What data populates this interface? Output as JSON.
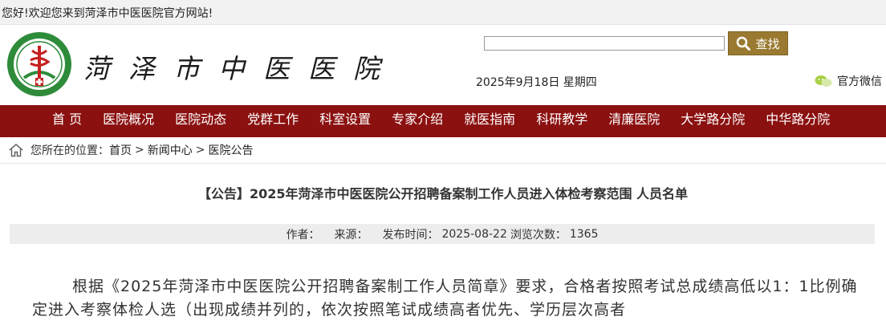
{
  "top_bar": {
    "welcome": "您好!欢迎您来到菏泽市中医医院官方网站!"
  },
  "header": {
    "logo_text": "菏泽市中医医院",
    "search": {
      "placeholder": "",
      "button_label": "查找"
    },
    "date": "2025年9月18日 星期四",
    "wechat_label": "官方微信"
  },
  "nav": {
    "items": [
      "首 页",
      "医院概况",
      "医院动态",
      "党群工作",
      "科室设置",
      "专家介绍",
      "就医指南",
      "科研教学",
      "清廉医院",
      "大学路分院",
      "中华路分院"
    ]
  },
  "breadcrumb": {
    "prefix": "您所在的位置：",
    "items": [
      "首页",
      "新闻中心",
      "医院公告"
    ],
    "separator": ">"
  },
  "article": {
    "title": "【公告】2025年菏泽市中医医院公开招聘备案制工作人员进入体检考察范围 人员名单",
    "meta": {
      "author_label": "作者：",
      "source_label": "来源：",
      "date_label": "发布时间：",
      "date_value": "2025-08-22",
      "views_label": "浏览次数：",
      "views_value": "1365"
    },
    "body": "根据《2025年菏泽市中医医院公开招聘备案制工作人员简章》要求，合格者按照考试总成绩高低以1：1比例确定进入考察体检人选（出现成绩并列的，依次按照笔试成绩高者优先、学历层次高者"
  },
  "colors": {
    "nav_bg": "#8b1010",
    "search_button": "#9a7a30",
    "logo_green": "#2e8b3a",
    "logo_red": "#c62020"
  }
}
